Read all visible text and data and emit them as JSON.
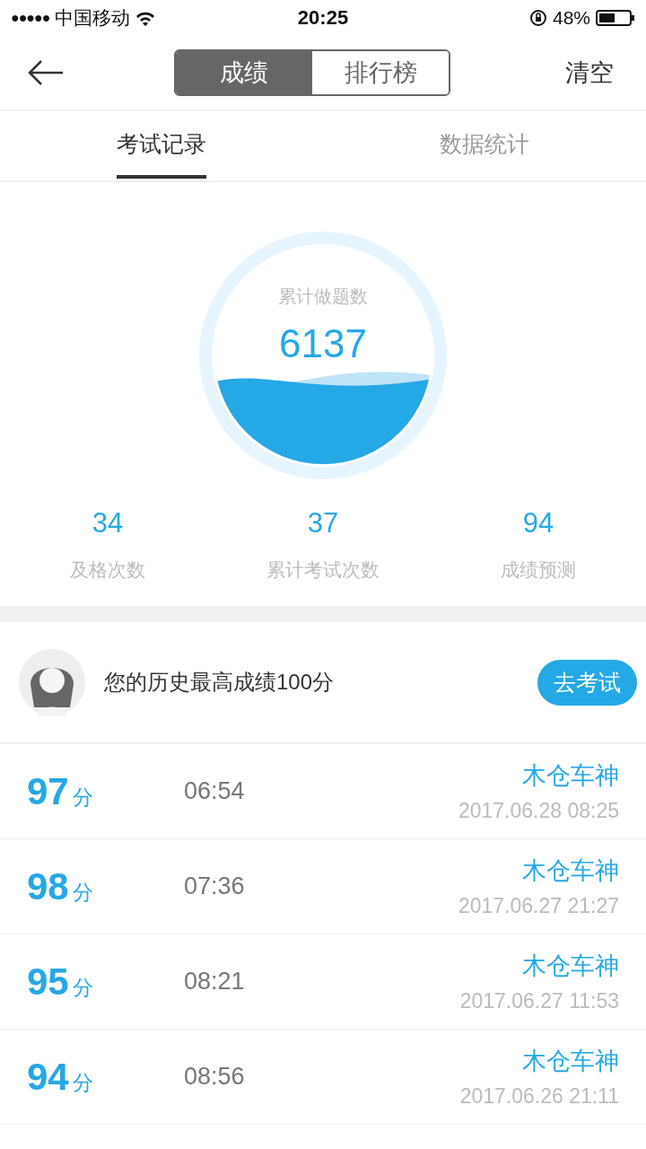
{
  "status_bar": {
    "signal_dots": "●●●●●",
    "carrier": "中国移动",
    "time": "20:25",
    "battery": "48%"
  },
  "nav": {
    "segments": [
      {
        "label": "成绩",
        "selected": true
      },
      {
        "label": "排行榜",
        "selected": false
      }
    ],
    "action": "清空"
  },
  "tabs": [
    {
      "label": "考试记录",
      "selected": true
    },
    {
      "label": "数据统计",
      "selected": false
    }
  ],
  "gauge": {
    "caption": "累计做题数",
    "value": "6137"
  },
  "stats": [
    {
      "value": "34",
      "label": "及格次数"
    },
    {
      "value": "37",
      "label": "累计考试次数"
    },
    {
      "value": "94",
      "label": "成绩预测"
    }
  ],
  "best": {
    "text": "您的历史最高成绩100分",
    "button": "去考试"
  },
  "records": [
    {
      "score": "97",
      "unit": "分",
      "duration": "06:54",
      "mode": "木仓车神",
      "date": "2017.06.28 08:25"
    },
    {
      "score": "98",
      "unit": "分",
      "duration": "07:36",
      "mode": "木仓车神",
      "date": "2017.06.27 21:27"
    },
    {
      "score": "95",
      "unit": "分",
      "duration": "08:21",
      "mode": "木仓车神",
      "date": "2017.06.27 11:53"
    },
    {
      "score": "94",
      "unit": "分",
      "duration": "08:56",
      "mode": "木仓车神",
      "date": "2017.06.26 21:11"
    }
  ]
}
